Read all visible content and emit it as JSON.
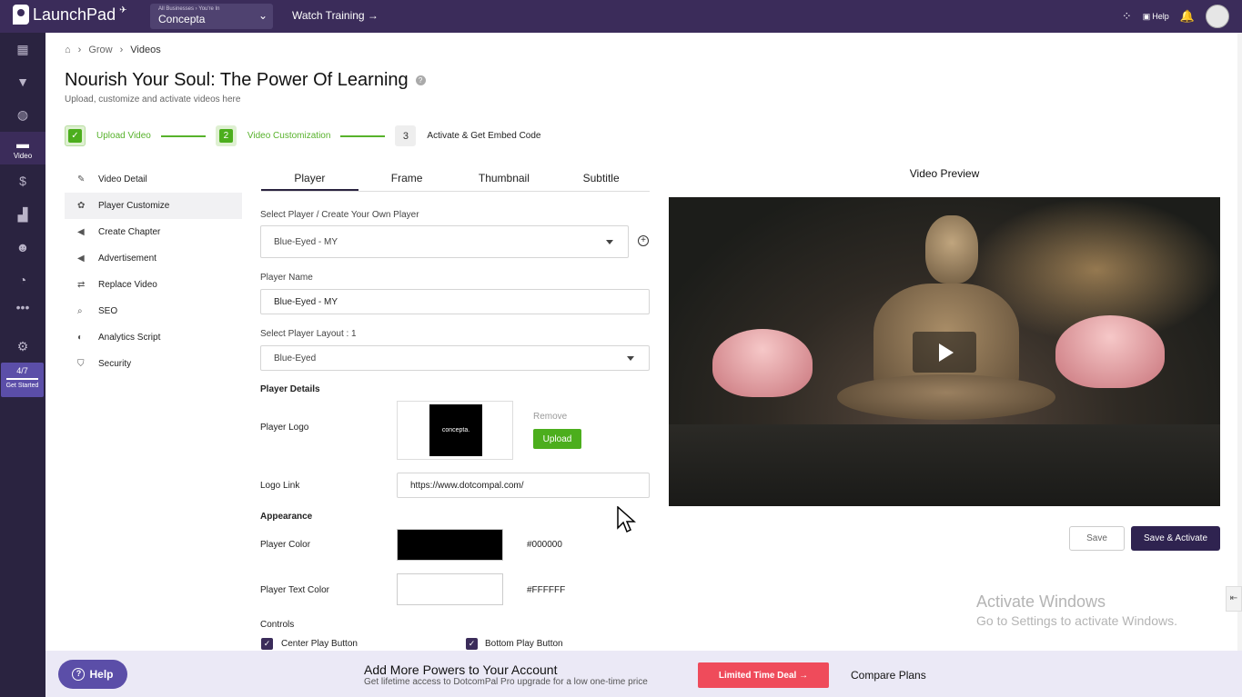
{
  "topbar": {
    "brand": "LaunchPad",
    "business_sub": "All Businesses › You're In",
    "business_name": "Concepta",
    "watch_training": "Watch Training →",
    "help": "Help"
  },
  "sidenav": {
    "video_label": "Video",
    "progress": "4/7",
    "get_started": "Get Started"
  },
  "breadcrumb": {
    "items": [
      "Grow",
      "Videos"
    ]
  },
  "page": {
    "title": "Nourish Your Soul: The Power Of Learning",
    "subtitle": "Upload, customize and activate videos here"
  },
  "stepper": {
    "steps": [
      {
        "num": "",
        "label": "Upload Video",
        "state": "done"
      },
      {
        "num": "2",
        "label": "Video Customization",
        "state": "current"
      },
      {
        "num": "3",
        "label": "Activate & Get Embed Code",
        "state": "pending"
      }
    ]
  },
  "leftmenu": {
    "items": [
      {
        "label": "Video Detail",
        "icon": "edit-icon"
      },
      {
        "label": "Player Customize",
        "icon": "palette-icon"
      },
      {
        "label": "Create Chapter",
        "icon": "megaphone-icon"
      },
      {
        "label": "Advertisement",
        "icon": "megaphone-icon"
      },
      {
        "label": "Replace Video",
        "icon": "swap-icon"
      },
      {
        "label": "SEO",
        "icon": "search-icon"
      },
      {
        "label": "Analytics Script",
        "icon": "analytics-icon"
      },
      {
        "label": "Security",
        "icon": "shield-icon"
      }
    ]
  },
  "tabs": [
    "Player",
    "Frame",
    "Thumbnail",
    "Subtitle"
  ],
  "form": {
    "select_player_label": "Select Player / Create Your Own Player",
    "select_player_value": "Blue-Eyed - MY",
    "player_name_label": "Player Name",
    "player_name_value": "Blue-Eyed - MY",
    "layout_label": "Select Player Layout : 1",
    "layout_value": "Blue-Eyed",
    "player_details": "Player Details",
    "player_logo": "Player Logo",
    "logo_text": "concepta.",
    "remove": "Remove",
    "upload": "Upload",
    "logo_link_label": "Logo Link",
    "logo_link_value": "https://www.dotcompal.com/",
    "appearance": "Appearance",
    "player_color_label": "Player Color",
    "player_color_hex": "#000000",
    "player_text_color_label": "Player Text Color",
    "player_text_color_hex": "#FFFFFF",
    "controls": "Controls",
    "center_play": "Center Play Button",
    "bottom_play": "Bottom Play Button"
  },
  "preview": {
    "title": "Video Preview",
    "save": "Save",
    "save_activate": "Save & Activate"
  },
  "watermark": {
    "line1": "Activate Windows",
    "line2": "Go to Settings to activate Windows."
  },
  "footer": {
    "help": "Help",
    "promo_title": "Add More Powers to Your Account",
    "promo_sub": "Get lifetime access to DotcomPal Pro upgrade for a low one-time price",
    "deal": "Limited Time Deal →",
    "compare": "Compare Plans"
  },
  "colors": {
    "brand": "#3b2c5a",
    "accent_green": "#4cae1d",
    "deal_red": "#ef4b5b"
  }
}
